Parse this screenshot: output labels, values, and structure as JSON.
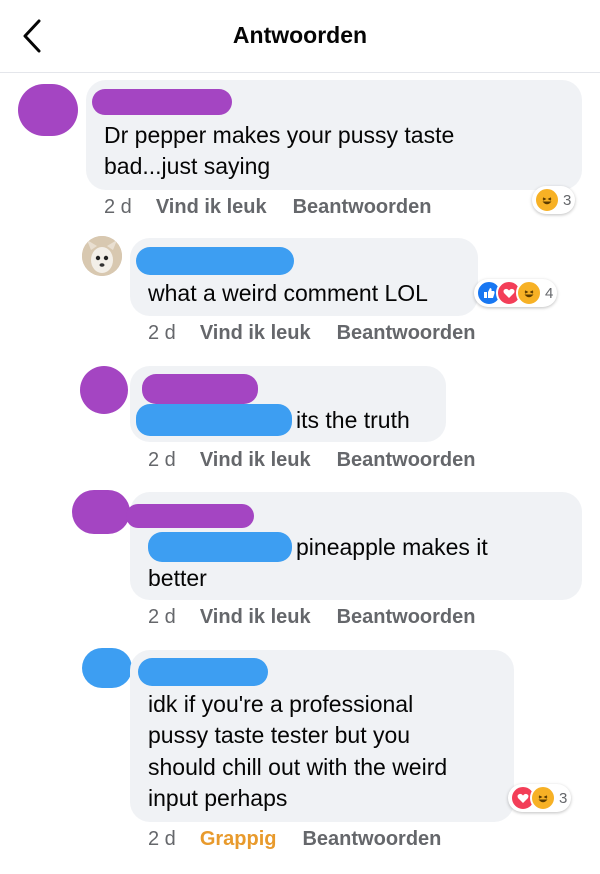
{
  "header": {
    "title": "Antwoorden"
  },
  "comments": [
    {
      "text_lines": [
        "Dr pepper makes your pussy taste",
        "bad...just saying"
      ],
      "time": "2 d",
      "like_label": "Vind ik leuk",
      "reply_label": "Beantwoorden",
      "reactions": [
        "haha-icon"
      ],
      "reaction_count": "3"
    },
    {
      "text_lines": [
        "what a weird comment LOL"
      ],
      "time": "2 d",
      "like_label": "Vind ik leuk",
      "reply_label": "Beantwoorden",
      "reactions": [
        "like-icon",
        "love-icon",
        "haha-icon"
      ],
      "reaction_count": "4"
    },
    {
      "text_lines": [
        "its the truth"
      ],
      "time": "2 d",
      "like_label": "Vind ik leuk",
      "reply_label": "Beantwoorden",
      "reactions": [],
      "reaction_count": ""
    },
    {
      "text_lines": [
        "pineapple makes it",
        "better"
      ],
      "time": "2 d",
      "like_label": "Vind ik leuk",
      "reply_label": "Beantwoorden",
      "reactions": [],
      "reaction_count": ""
    },
    {
      "text_lines": [
        "idk if you're a professional",
        "pussy taste tester but you",
        "should chill out with the weird",
        "input perhaps"
      ],
      "time": "2 d",
      "like_label": "Grappig",
      "reply_label": "Beantwoorden",
      "reactions": [
        "love-icon",
        "haha-icon"
      ],
      "reaction_count": "3"
    }
  ],
  "colors": {
    "redact_purple": "#a445c2",
    "redact_blue": "#3d9ef2",
    "bubble_bg": "#f0f2f5",
    "action_gray": "#65676b",
    "funny_orange": "#e89a2c"
  }
}
